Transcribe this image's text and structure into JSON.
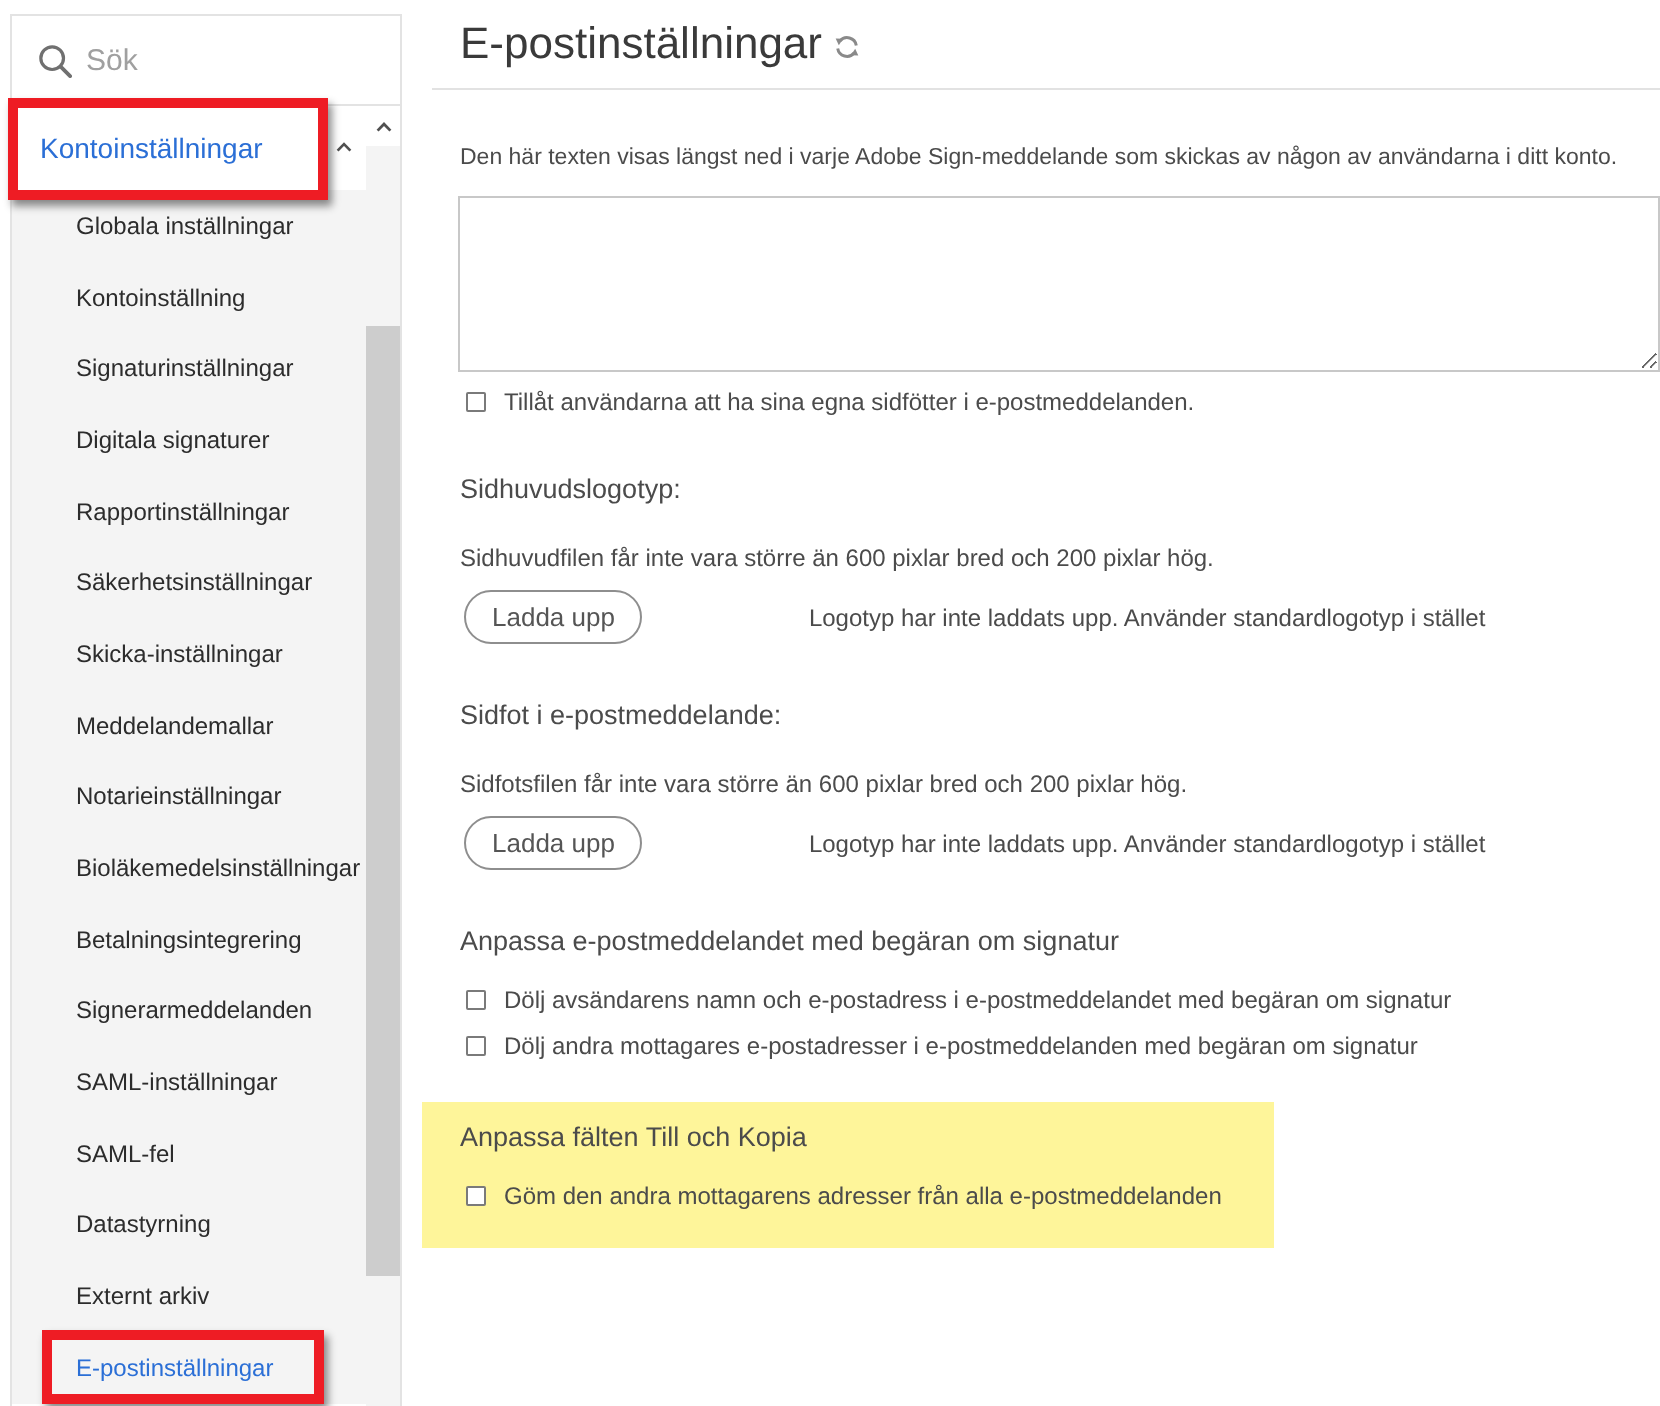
{
  "sidebar": {
    "search": {
      "placeholder": "Sök"
    },
    "group": {
      "label": "Kontoinställningar",
      "expanded": true,
      "annotated": true,
      "items": [
        {
          "label": "Globala inställningar",
          "selected": false,
          "annotated": false
        },
        {
          "label": "Kontoinställning",
          "selected": false,
          "annotated": false
        },
        {
          "label": "Signaturinställningar",
          "selected": false,
          "annotated": false
        },
        {
          "label": "Digitala signaturer",
          "selected": false,
          "annotated": false
        },
        {
          "label": "Rapportinställningar",
          "selected": false,
          "annotated": false
        },
        {
          "label": "Säkerhetsinställningar",
          "selected": false,
          "annotated": false
        },
        {
          "label": "Skicka-inställningar",
          "selected": false,
          "annotated": false
        },
        {
          "label": "Meddelandemallar",
          "selected": false,
          "annotated": false
        },
        {
          "label": "Notarieinställningar",
          "selected": false,
          "annotated": false
        },
        {
          "label": "Bioläkemedelsinställningar",
          "selected": false,
          "annotated": false
        },
        {
          "label": "Betalningsintegrering",
          "selected": false,
          "annotated": false
        },
        {
          "label": "Signerarmeddelanden",
          "selected": false,
          "annotated": false
        },
        {
          "label": "SAML-inställningar",
          "selected": false,
          "annotated": false
        },
        {
          "label": "SAML-fel",
          "selected": false,
          "annotated": false
        },
        {
          "label": "Datastyrning",
          "selected": false,
          "annotated": false
        },
        {
          "label": "Externt arkiv",
          "selected": false,
          "annotated": false
        },
        {
          "label": "E-postinställningar",
          "selected": true,
          "annotated": true
        }
      ]
    }
  },
  "page": {
    "title": "E-postinställningar"
  },
  "sections": [
    {
      "kind": "text_field",
      "highlighted": false,
      "description": "Den här texten visas längst ned i varje Adobe Sign-meddelande som skickas av någon av användarna i ditt konto.",
      "options": [
        {
          "label": "Tillåt användarna att ha sina egna sidfötter i e-postmeddelanden.",
          "checked": false
        }
      ]
    },
    {
      "kind": "upload",
      "highlighted": false,
      "heading": "Sidhuvudslogotyp:",
      "hint": "Sidhuvudfilen får inte vara större än 600 pixlar bred och 200 pixlar hög.",
      "button": "Ladda upp",
      "status": "Logotyp har inte laddats upp. Använder standardlogotyp i stället"
    },
    {
      "kind": "upload",
      "highlighted": false,
      "heading": "Sidfot i e-postmeddelande:",
      "hint": "Sidfotsfilen får inte vara större än 600 pixlar bred och 200 pixlar hög.",
      "button": "Ladda upp",
      "status": "Logotyp har inte laddats upp. Använder standardlogotyp i stället"
    },
    {
      "kind": "options",
      "highlighted": false,
      "heading": "Anpassa e-postmeddelandet med begäran om signatur",
      "options": [
        {
          "label": "Dölj avsändarens namn och e-postadress i e-postmeddelandet med begäran om signatur",
          "checked": false
        },
        {
          "label": "Dölj andra mottagares e-postadresser i e-postmeddelanden med begäran om signatur",
          "checked": false
        }
      ]
    },
    {
      "kind": "options",
      "highlighted": true,
      "heading": "Anpassa fälten Till och Kopia",
      "options": [
        {
          "label": "Göm den andra mottagarens adresser från alla e-postmeddelanden",
          "checked": false
        }
      ]
    }
  ]
}
